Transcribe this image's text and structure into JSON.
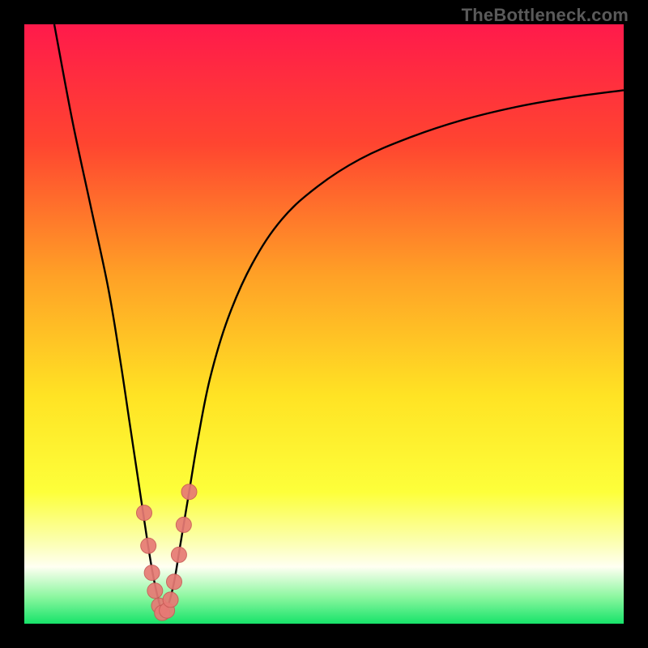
{
  "watermark": {
    "text": "TheBottleneck.com"
  },
  "colors": {
    "frame": "#000000",
    "curve": "#000000",
    "marker_fill": "#e77a75",
    "marker_stroke": "#c95b57",
    "gradient_stops": [
      {
        "offset": 0.0,
        "color": "#ff1a4b"
      },
      {
        "offset": 0.2,
        "color": "#ff4530"
      },
      {
        "offset": 0.42,
        "color": "#ffa126"
      },
      {
        "offset": 0.62,
        "color": "#ffe324"
      },
      {
        "offset": 0.78,
        "color": "#fdff3a"
      },
      {
        "offset": 0.86,
        "color": "#fbffab"
      },
      {
        "offset": 0.905,
        "color": "#fffff2"
      },
      {
        "offset": 0.955,
        "color": "#8cf7a0"
      },
      {
        "offset": 1.0,
        "color": "#17e36a"
      }
    ]
  },
  "chart_data": {
    "type": "line",
    "title": "",
    "xlabel": "",
    "ylabel": "",
    "xlim": [
      0,
      100
    ],
    "ylim": [
      0,
      100
    ],
    "grid": false,
    "legend": false,
    "series": [
      {
        "name": "bottleneck-curve",
        "x": [
          5,
          8,
          11,
          14,
          16,
          17.5,
          19,
          20.5,
          21.5,
          22.5,
          23.2,
          24,
          25,
          26,
          27.5,
          29,
          31,
          34,
          38,
          43,
          49,
          56,
          64,
          73,
          82,
          91,
          100
        ],
        "y": [
          100,
          84,
          70,
          56,
          44,
          34,
          24,
          14,
          8,
          3.5,
          1.5,
          3,
          7,
          13,
          22,
          31,
          41,
          51,
          60,
          67.5,
          73,
          77.5,
          81,
          84,
          86.2,
          87.8,
          89
        ]
      }
    ],
    "markers": {
      "name": "highlighted-points",
      "points": [
        {
          "x": 20.0,
          "y": 18.5
        },
        {
          "x": 20.7,
          "y": 13.0
        },
        {
          "x": 21.3,
          "y": 8.5
        },
        {
          "x": 21.8,
          "y": 5.5
        },
        {
          "x": 22.5,
          "y": 3.0
        },
        {
          "x": 23.0,
          "y": 1.8
        },
        {
          "x": 23.8,
          "y": 2.2
        },
        {
          "x": 24.4,
          "y": 4.0
        },
        {
          "x": 25.0,
          "y": 7.0
        },
        {
          "x": 25.8,
          "y": 11.5
        },
        {
          "x": 26.6,
          "y": 16.5
        },
        {
          "x": 27.5,
          "y": 22.0
        }
      ]
    }
  }
}
